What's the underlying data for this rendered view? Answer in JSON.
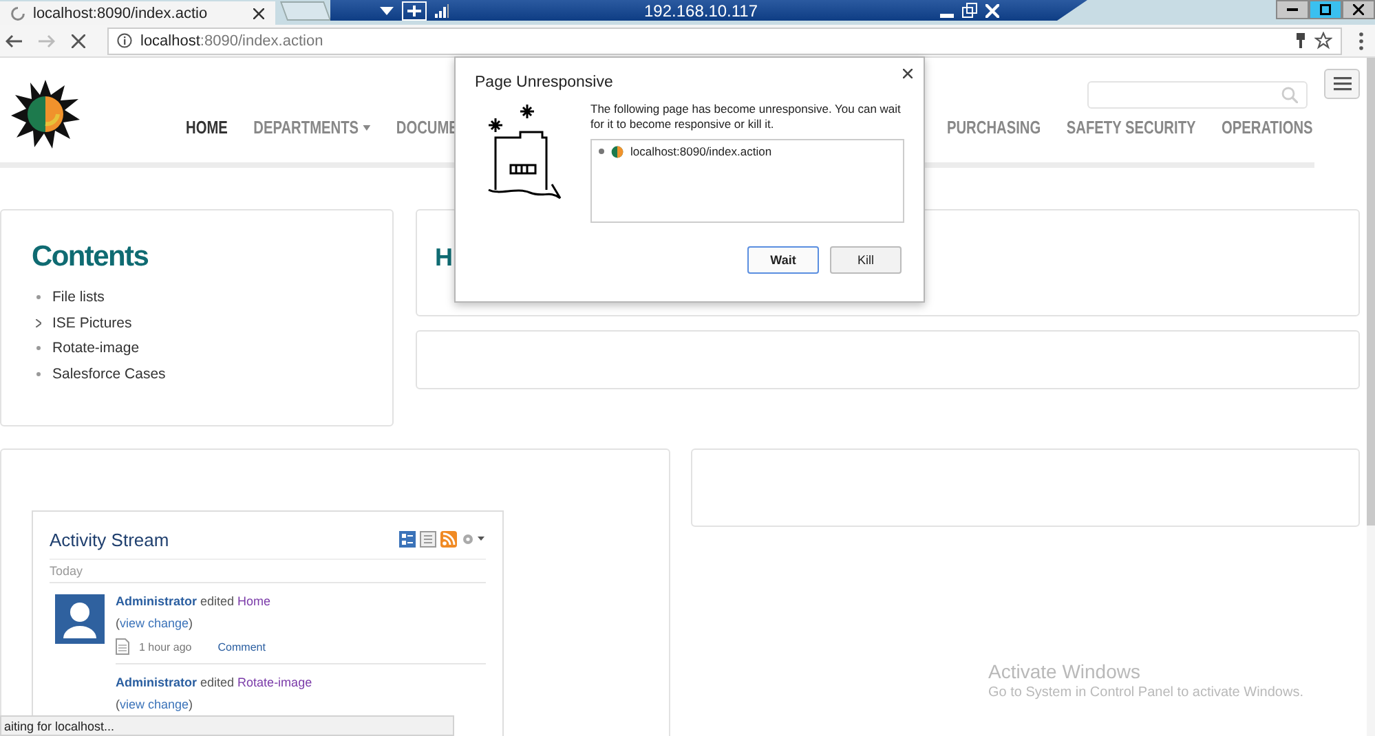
{
  "browser": {
    "tab": {
      "title": "localhost:8090/index.actio",
      "loading": true
    },
    "remote_bar": {
      "address": "192.168.10.117"
    },
    "address": {
      "host": "localhost",
      "path": ":8090/index.action"
    }
  },
  "nav": {
    "left": [
      {
        "label": "HOME",
        "selected": true,
        "has_menu": false
      },
      {
        "label": "DEPARTMENTS",
        "selected": false,
        "has_menu": true
      },
      {
        "label": "DOCUME",
        "selected": false,
        "has_menu": false
      }
    ],
    "right": [
      {
        "label": "PURCHASING",
        "selected": false,
        "has_menu": false
      },
      {
        "label": "SAFETY SECURITY",
        "selected": false,
        "has_menu": false
      },
      {
        "label": "OPERATIONS",
        "selected": false,
        "has_menu": false
      }
    ]
  },
  "contents": {
    "title": "Contents",
    "items": [
      {
        "label": "File lists",
        "kind": "bullet"
      },
      {
        "label": "ISE Pictures",
        "kind": "arrow"
      },
      {
        "label": "Rotate-image",
        "kind": "bullet"
      },
      {
        "label": "Salesforce Cases",
        "kind": "bullet"
      }
    ]
  },
  "panel_heading": "H",
  "activity": {
    "title": "Activity Stream",
    "group": "Today",
    "entries": [
      {
        "user": "Administrator",
        "verb": "edited",
        "page": "Home",
        "prefix": "(",
        "link": "view change",
        "suffix": ")",
        "avatar": true,
        "time": "1 hour ago",
        "action": "Comment"
      },
      {
        "user": "Administrator",
        "verb": "edited",
        "page": "Rotate-image",
        "prefix": "(",
        "link": "view change",
        "suffix": ")",
        "avatar": false
      }
    ]
  },
  "dialog": {
    "title": "Page Unresponsive",
    "message": "The following page has become unresponsive. You can wait for it to become responsive or kill it.",
    "pages": [
      {
        "url": "localhost:8090/index.action"
      }
    ],
    "buttons": [
      {
        "label": "Wait",
        "default": true
      },
      {
        "label": "Kill",
        "default": false
      }
    ]
  },
  "status_bar": {
    "text": "aiting for localhost..."
  },
  "activation_notice": {
    "title": "Activate Windows",
    "subtitle": "Go to System in Control Panel to activate Windows."
  }
}
